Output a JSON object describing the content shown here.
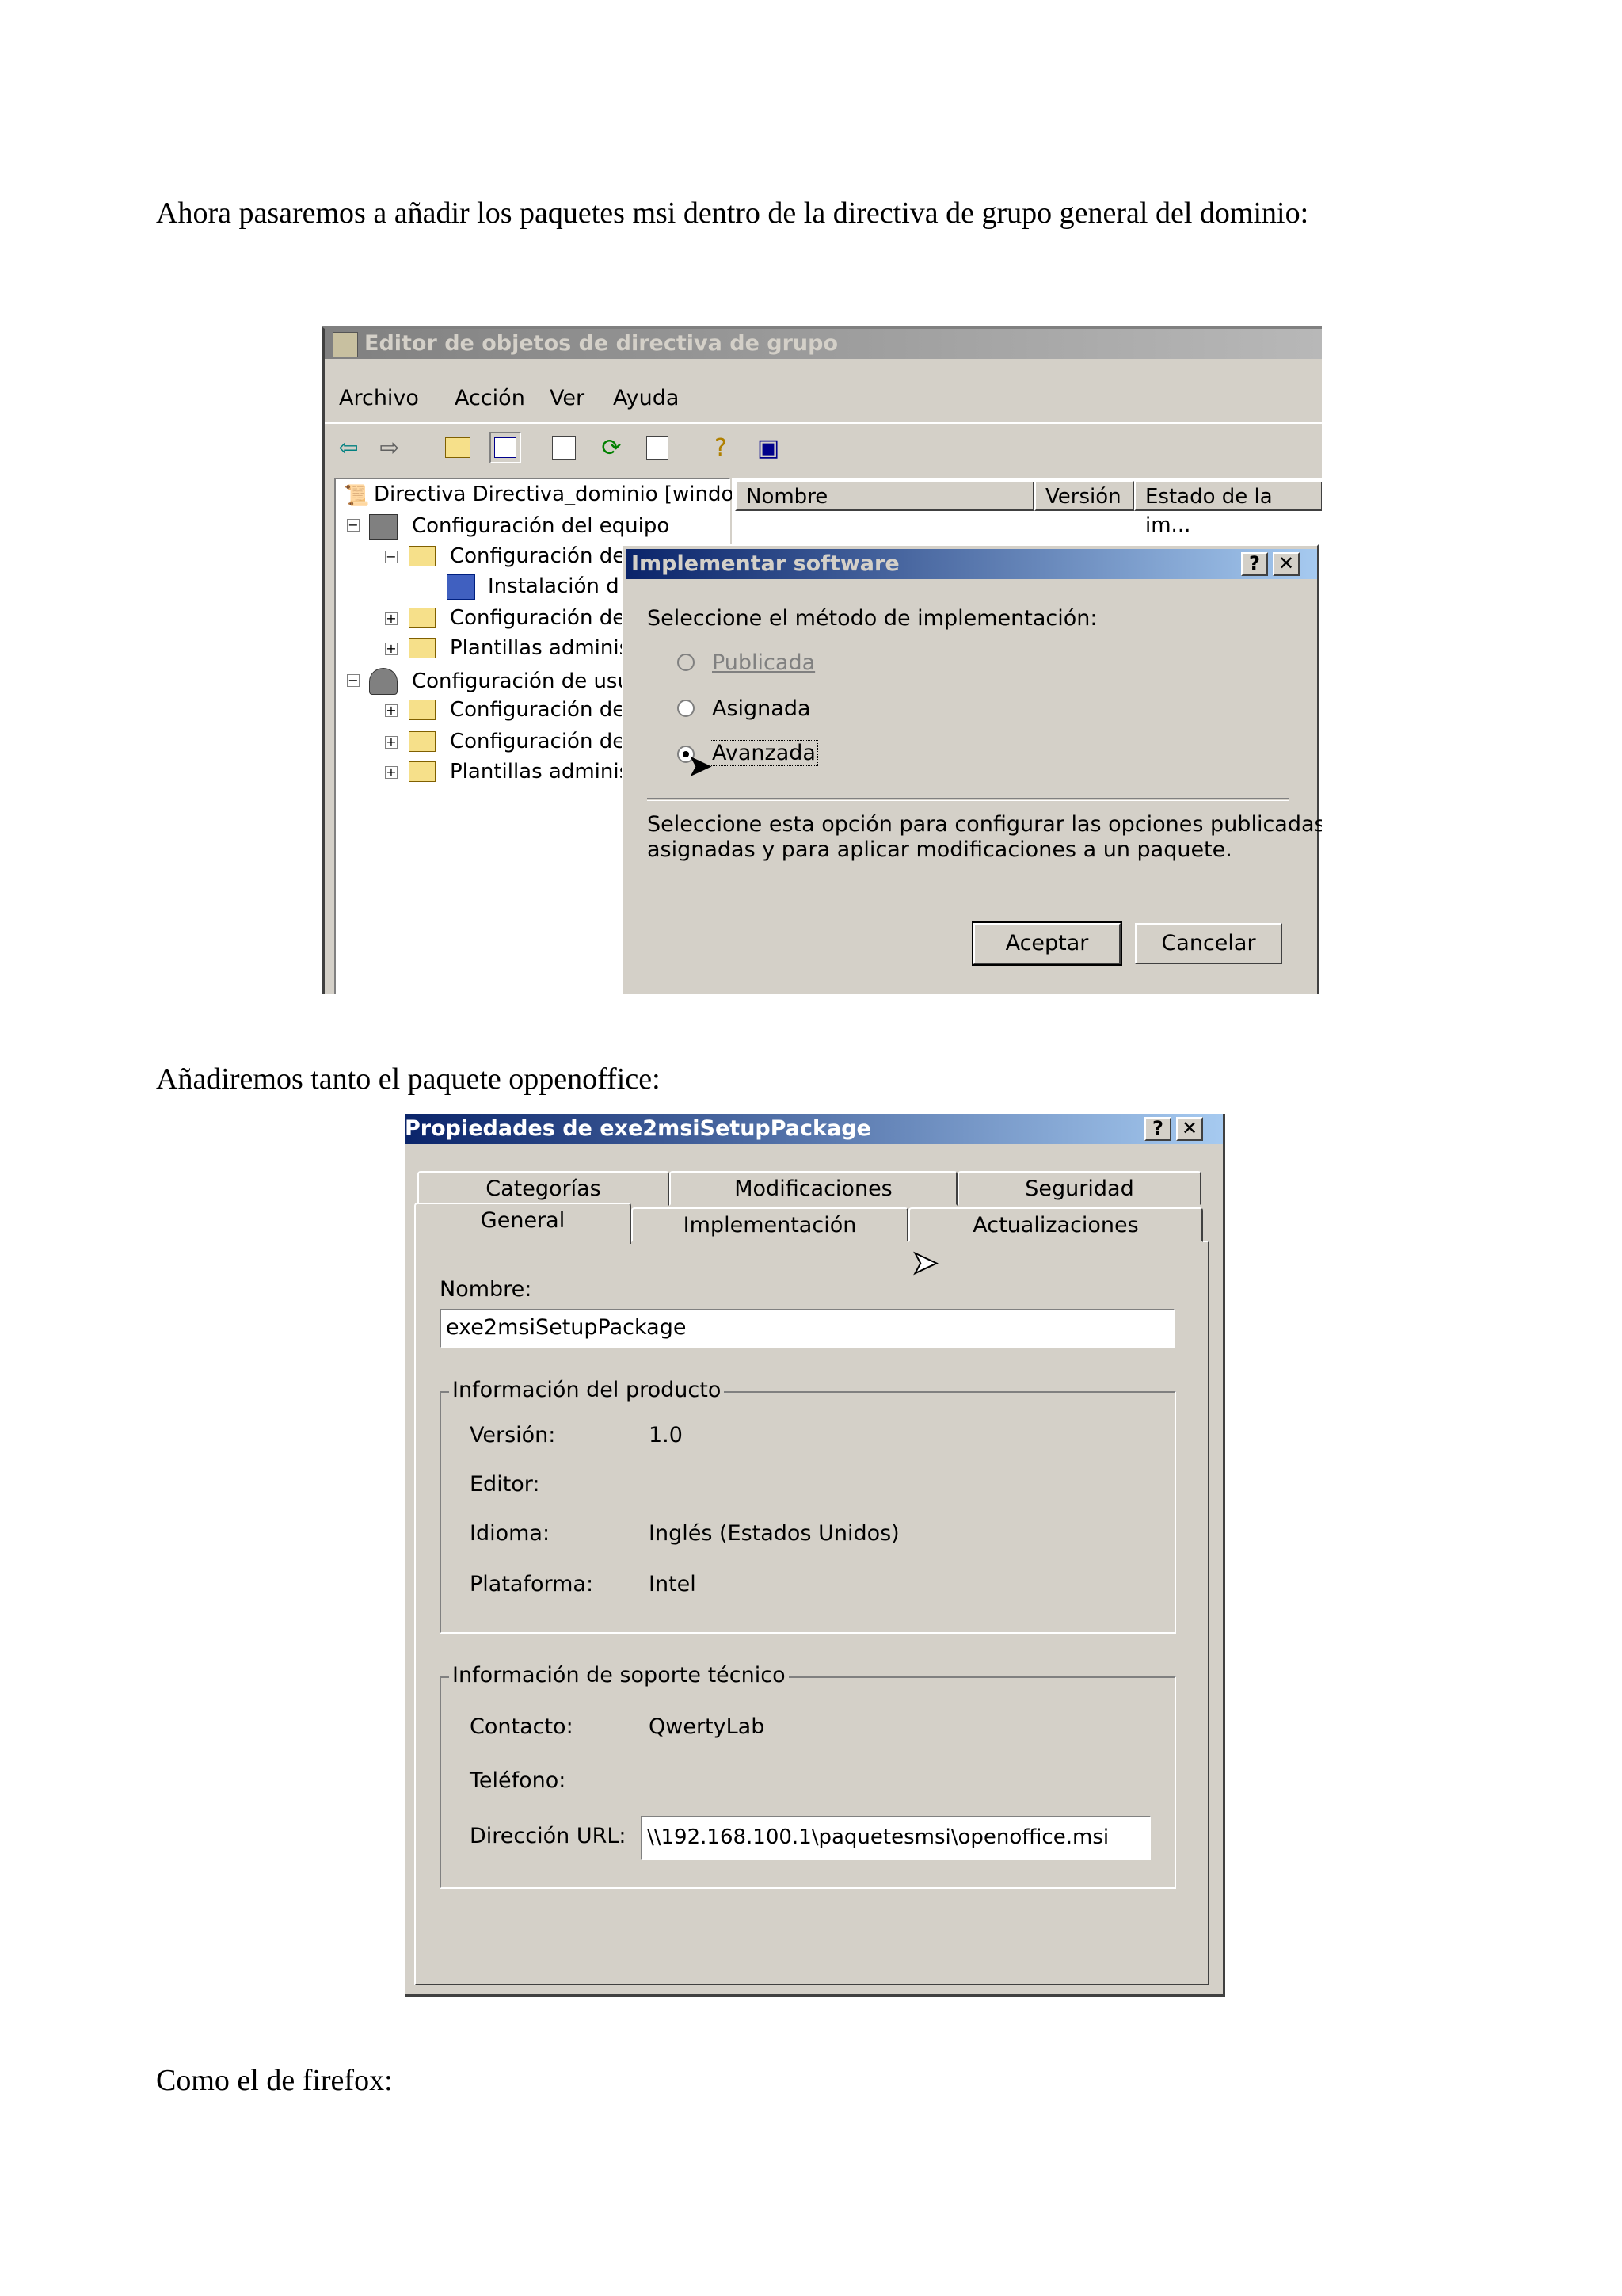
{
  "paragraphs": {
    "intro": "Ahora pasaremos a añadir los paquetes msi dentro de la directiva de grupo general del dominio:",
    "openoffice": "Añadiremos tanto el paquete oppenoffice:",
    "firefox": "Como el de firefox:"
  },
  "gpo_editor": {
    "title": "Editor de objetos de directiva de grupo",
    "menu": [
      "Archivo",
      "Acción",
      "Ver",
      "Ayuda"
    ],
    "tree": [
      "Directiva Directiva_dominio [windoᴜ",
      "Configuración del equipo",
      "Configuración de",
      "Instalación d",
      "Configuración de",
      "Plantillas adminis",
      "Configuración de usu",
      "Configuración de",
      "Configuración de",
      "Plantillas adminis"
    ],
    "columns": [
      "Nombre",
      "Versión",
      "Estado de la im..."
    ]
  },
  "deploy_dialog": {
    "title": "Implementar software",
    "help": "?",
    "close": "✕",
    "prompt": "Seleccione el método de implementación:",
    "options": [
      {
        "label": "Publicada",
        "state": "disabled"
      },
      {
        "label": "Asignada",
        "state": "unchecked"
      },
      {
        "label": "Avanzada",
        "state": "checked"
      }
    ],
    "description_line1": "Seleccione esta opción para configurar las opciones publicadas o",
    "description_line2": "asignadas y para aplicar modificaciones a un paquete.",
    "ok": "Aceptar",
    "cancel": "Cancelar"
  },
  "properties": {
    "title": "Propiedades de exe2msiSetupPackage",
    "help": "?",
    "close": "✕",
    "tabs_back": [
      "Categorías",
      "Modificaciones",
      "Seguridad"
    ],
    "tabs_front": [
      "General",
      "Implementación",
      "Actualizaciones"
    ],
    "name_label": "Nombre:",
    "name_value": "exe2msiSetupPackage",
    "product_group": "Información del producto",
    "version_label": "Versión:",
    "version_value": "1.0",
    "editor_label": "Editor:",
    "language_label": "Idioma:",
    "language_value": "Inglés (Estados Unidos)",
    "platform_label": "Plataforma:",
    "platform_value": "Intel",
    "support_group": "Información de soporte técnico",
    "contact_label": "Contacto:",
    "contact_value": "QwertyLab",
    "phone_label": "Teléfono:",
    "url_label": "Dirección URL:",
    "url_value": "\\\\192.168.100.1\\paquetesmsi\\openoffice.msi"
  },
  "icons": {
    "back": "arrow-left-icon",
    "forward": "arrow-right-icon",
    "cursor": "mouse-pointer-icon"
  },
  "colors": {
    "active_title": "#0a246a",
    "inactive_title": "#808080",
    "face": "#d4d0c8"
  }
}
